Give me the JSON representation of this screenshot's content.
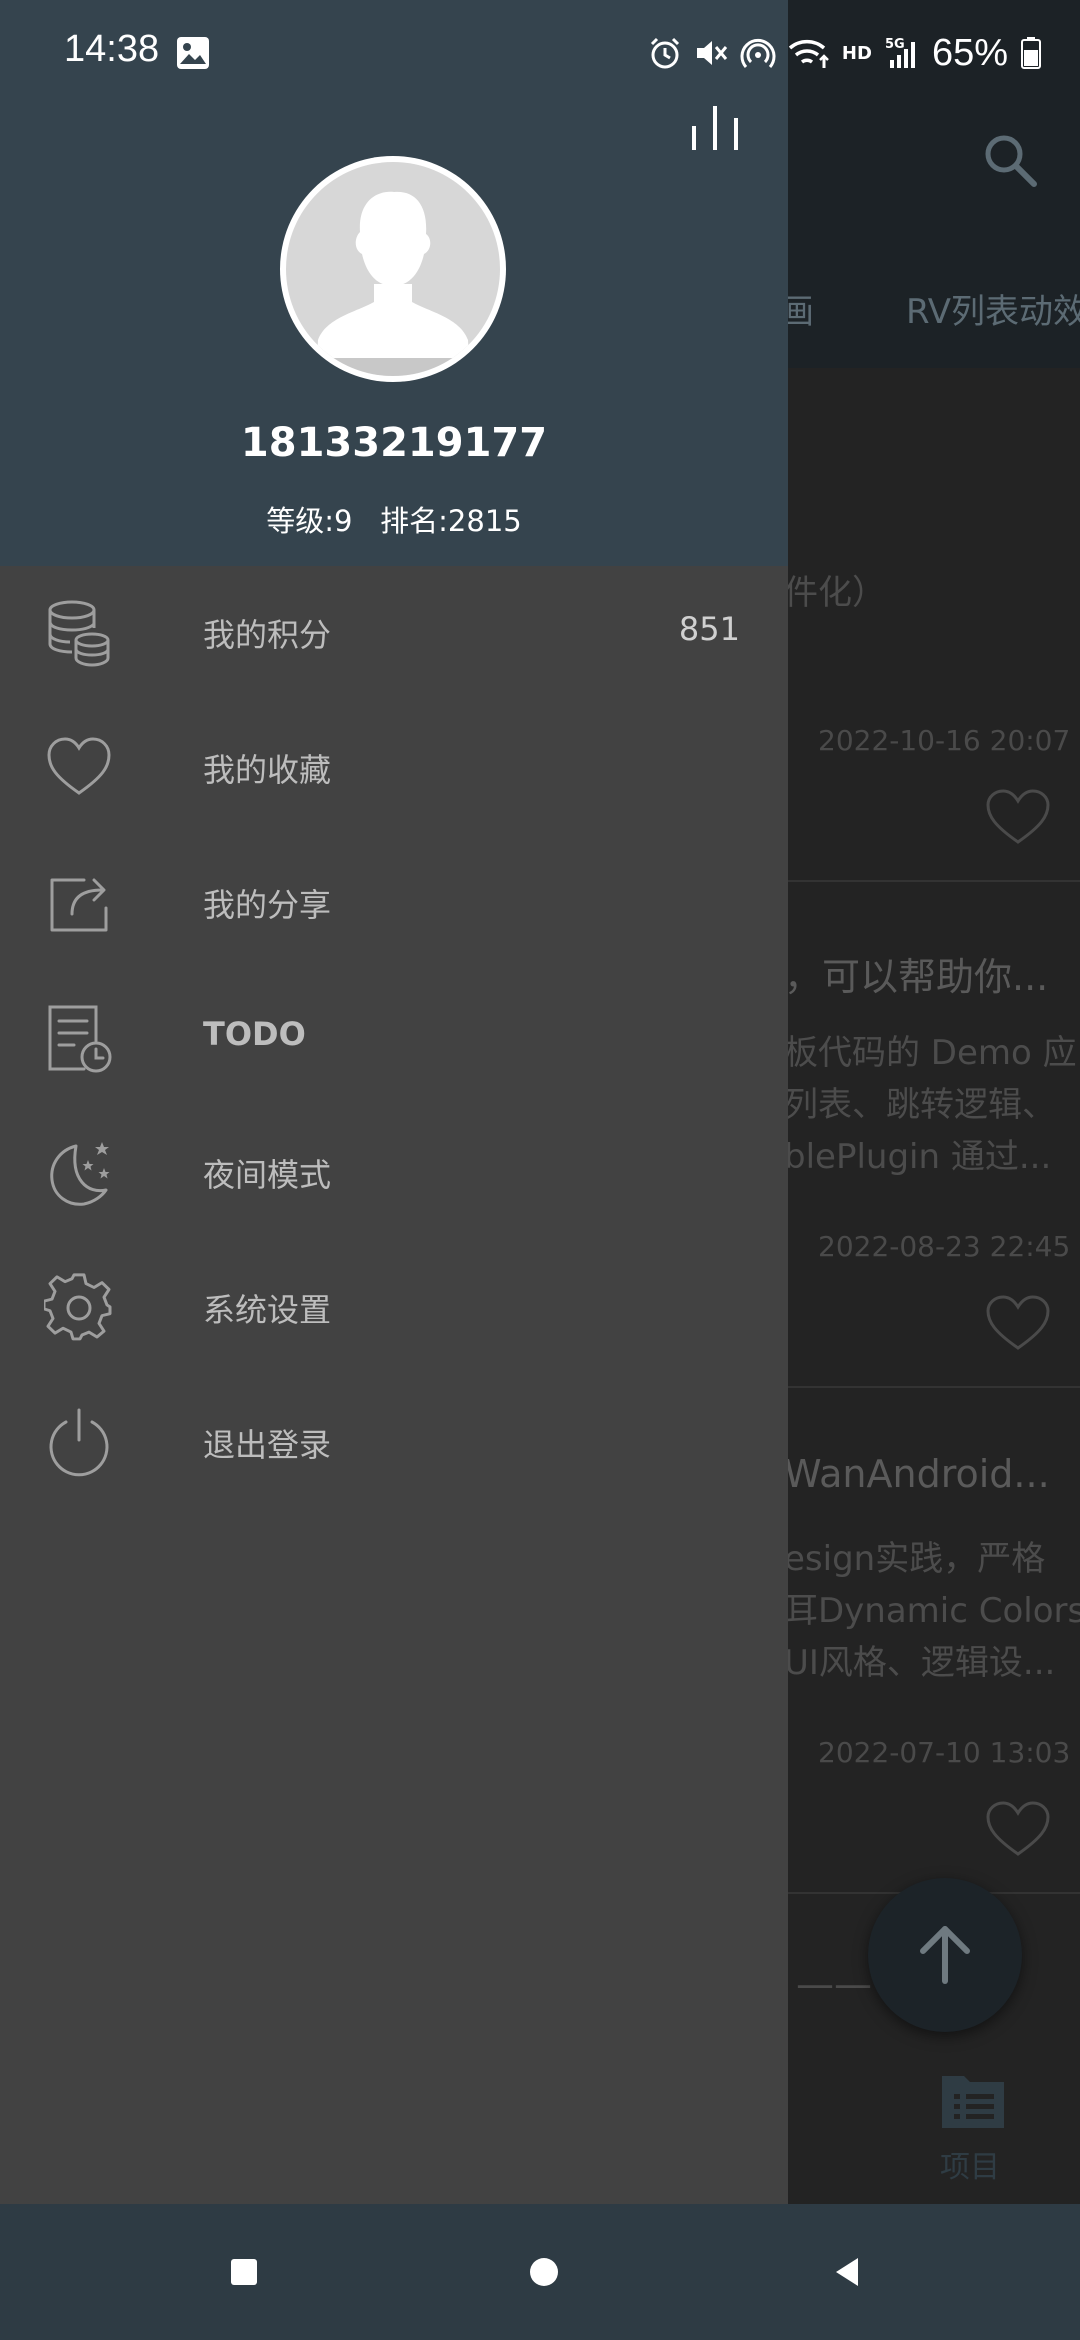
{
  "status_bar": {
    "time": "14:38",
    "battery": "65%",
    "icons": [
      "gallery-icon",
      "alarm-icon",
      "mute-icon",
      "hotspot-icon",
      "wifi-icon",
      "hd-icon",
      "5g-signal-icon",
      "battery-icon"
    ],
    "hd_label": "HD",
    "network_label": "5G"
  },
  "drawer": {
    "username": "18133219177",
    "stats": "等级:9   排名:2815",
    "menu": [
      {
        "label": "我的积分",
        "value": "851",
        "icon": "coins-icon"
      },
      {
        "label": "我的收藏",
        "icon": "heart-icon"
      },
      {
        "label": "我的分享",
        "icon": "share-icon"
      },
      {
        "label": "TODO",
        "icon": "todo-icon"
      },
      {
        "label": "夜间模式",
        "icon": "night-mode-icon"
      },
      {
        "label": "系统设置",
        "icon": "settings-icon"
      },
      {
        "label": "退出登录",
        "icon": "power-icon"
      }
    ]
  },
  "background": {
    "tabs": [
      "画",
      "RV列表动效"
    ],
    "articles": [
      {
        "snippet": "件化）",
        "date": "2022-10-16 20:07"
      },
      {
        "title": "，可以帮助你...",
        "lines": [
          "板代码的 Demo 应",
          "列表、跳转逻辑、",
          "blePlugin 通过..."
        ],
        "date": "2022-08-23 22:45"
      },
      {
        "title": "WanAndroid...",
        "lines": [
          "esign实践，严格",
          "耳Dynamic Colors",
          "UI风格、逻辑设..."
        ],
        "date": "2022-07-10 13:03"
      },
      {
        "title": "—— ..."
      }
    ],
    "bottom_nav_label": "项目"
  },
  "colors": {
    "drawer_header": "#35444e",
    "drawer_body": "#424242",
    "nav_bar": "#2e3b44"
  }
}
